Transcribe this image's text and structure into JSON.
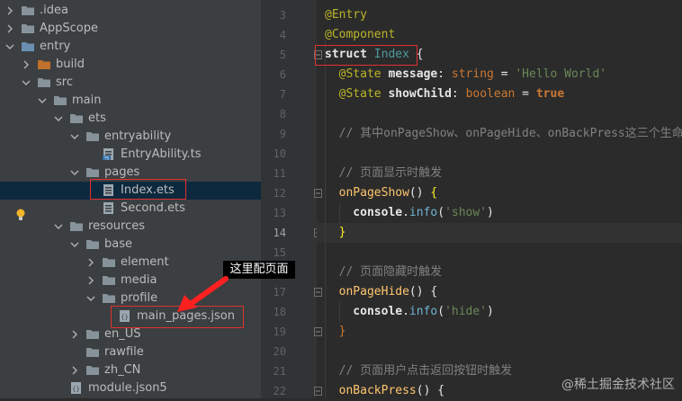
{
  "tree": {
    "rows": [
      {
        "label": ".idea",
        "depth": 0,
        "expanded": false,
        "icon": "folder-icon"
      },
      {
        "label": "AppScope",
        "depth": 0,
        "expanded": false,
        "icon": "folder-icon"
      },
      {
        "label": "entry",
        "depth": 0,
        "expanded": true,
        "icon": "module-folder-icon"
      },
      {
        "label": "build",
        "depth": 1,
        "expanded": false,
        "icon": "build-folder-icon"
      },
      {
        "label": "src",
        "depth": 1,
        "expanded": true,
        "icon": "folder-icon"
      },
      {
        "label": "main",
        "depth": 2,
        "expanded": true,
        "icon": "folder-icon"
      },
      {
        "label": "ets",
        "depth": 3,
        "expanded": true,
        "icon": "folder-icon"
      },
      {
        "label": "entryability",
        "depth": 4,
        "expanded": true,
        "icon": "folder-icon"
      },
      {
        "label": "EntryAbility.ts",
        "depth": 5,
        "expanded": null,
        "icon": "ts-file-icon"
      },
      {
        "label": "pages",
        "depth": 4,
        "expanded": true,
        "icon": "folder-icon"
      },
      {
        "label": "Index.ets",
        "depth": 5,
        "expanded": null,
        "icon": "ets-file-icon",
        "selected": true
      },
      {
        "label": "Second.ets",
        "depth": 5,
        "expanded": null,
        "icon": "ets-file-icon"
      },
      {
        "label": "resources",
        "depth": 3,
        "expanded": true,
        "icon": "folder-icon"
      },
      {
        "label": "base",
        "depth": 4,
        "expanded": true,
        "icon": "folder-icon"
      },
      {
        "label": "element",
        "depth": 5,
        "expanded": false,
        "icon": "folder-icon"
      },
      {
        "label": "media",
        "depth": 5,
        "expanded": false,
        "icon": "folder-icon"
      },
      {
        "label": "profile",
        "depth": 5,
        "expanded": true,
        "icon": "folder-icon"
      },
      {
        "label": "main_pages.json",
        "depth": 6,
        "expanded": null,
        "icon": "json-file-icon"
      },
      {
        "label": "en_US",
        "depth": 4,
        "expanded": false,
        "icon": "folder-icon"
      },
      {
        "label": "rawfile",
        "depth": 4,
        "expanded": null,
        "icon": "folder-icon"
      },
      {
        "label": "zh_CN",
        "depth": 4,
        "expanded": false,
        "icon": "folder-icon"
      },
      {
        "label": "module.json5",
        "depth": 3,
        "expanded": null,
        "icon": "json-file-icon"
      }
    ]
  },
  "annotation": {
    "callout_text": "这里配页面"
  },
  "editor": {
    "current_line": "14",
    "lines": [
      {
        "num": "3",
        "tokens": [
          {
            "t": "@Entry",
            "c": "dec"
          }
        ]
      },
      {
        "num": "4",
        "tokens": [
          {
            "t": "@Component",
            "c": "dec"
          }
        ]
      },
      {
        "num": "5",
        "tokens": [
          {
            "t": "struct",
            "c": "kw"
          },
          {
            "t": " ",
            "c": "pl"
          },
          {
            "t": "Index",
            "c": "cls"
          },
          {
            "t": " {",
            "c": "pl"
          }
        ]
      },
      {
        "num": "6",
        "tokens": [
          {
            "t": "  @State",
            "c": "dec"
          },
          {
            "t": " message",
            "c": "kw"
          },
          {
            "t": ": ",
            "c": "pl"
          },
          {
            "t": "string",
            "c": "k"
          },
          {
            "t": " = ",
            "c": "pl"
          },
          {
            "t": "'Hello World'",
            "c": "str"
          }
        ]
      },
      {
        "num": "7",
        "tokens": [
          {
            "t": "  @State",
            "c": "dec"
          },
          {
            "t": " showChild",
            "c": "kw"
          },
          {
            "t": ": ",
            "c": "pl"
          },
          {
            "t": "boolean",
            "c": "k"
          },
          {
            "t": " = ",
            "c": "pl"
          },
          {
            "t": "true",
            "c": "kb"
          }
        ]
      },
      {
        "num": "8",
        "tokens": []
      },
      {
        "num": "9",
        "tokens": [
          {
            "t": "  // 其中onPageShow、onPageHide、onBackPress这三个生命",
            "c": "cm"
          }
        ]
      },
      {
        "num": "10",
        "tokens": []
      },
      {
        "num": "11",
        "tokens": [
          {
            "t": "  // 页面显示时触发",
            "c": "cm"
          }
        ]
      },
      {
        "num": "12",
        "tokens": [
          {
            "t": "  onPageShow",
            "c": "fn"
          },
          {
            "t": "() ",
            "c": "pl"
          },
          {
            "t": "{",
            "c": "brk"
          }
        ]
      },
      {
        "num": "13",
        "tokens": [
          {
            "t": "    console",
            "c": "kw"
          },
          {
            "t": ".",
            "c": "pl"
          },
          {
            "t": "info",
            "c": "mt"
          },
          {
            "t": "(",
            "c": "pl"
          },
          {
            "t": "'show'",
            "c": "str"
          },
          {
            "t": ")",
            "c": "pl"
          }
        ]
      },
      {
        "num": "14",
        "tokens": [
          {
            "t": "  ",
            "c": "pl"
          },
          {
            "t": "}",
            "c": "brk"
          }
        ]
      },
      {
        "num": "15",
        "tokens": []
      },
      {
        "num": "16",
        "tokens": [
          {
            "t": "  // 页面隐藏时触发",
            "c": "cm"
          }
        ]
      },
      {
        "num": "17",
        "tokens": [
          {
            "t": "  onPageHide",
            "c": "fn"
          },
          {
            "t": "() {",
            "c": "pl"
          }
        ]
      },
      {
        "num": "18",
        "tokens": [
          {
            "t": "    console",
            "c": "kw"
          },
          {
            "t": ".",
            "c": "pl"
          },
          {
            "t": "info",
            "c": "mt"
          },
          {
            "t": "(",
            "c": "pl"
          },
          {
            "t": "'hide'",
            "c": "str"
          },
          {
            "t": ")",
            "c": "pl"
          }
        ]
      },
      {
        "num": "19",
        "tokens": [
          {
            "t": "  }",
            "c": "k"
          }
        ]
      },
      {
        "num": "20",
        "tokens": []
      },
      {
        "num": "21",
        "tokens": [
          {
            "t": "  // 页面用户点击返回按钮时触发",
            "c": "cm"
          }
        ]
      },
      {
        "num": "22",
        "tokens": [
          {
            "t": "  onBackPress",
            "c": "fn"
          },
          {
            "t": "() {",
            "c": "pl"
          }
        ]
      }
    ]
  },
  "watermark": "@稀土掘金技术社区",
  "colors": {
    "selection": "#0d293e",
    "annotation_red": "#e03030",
    "folder": "#87939a",
    "build_folder": "#c0712b",
    "module_folder": "#6a8fb3"
  }
}
